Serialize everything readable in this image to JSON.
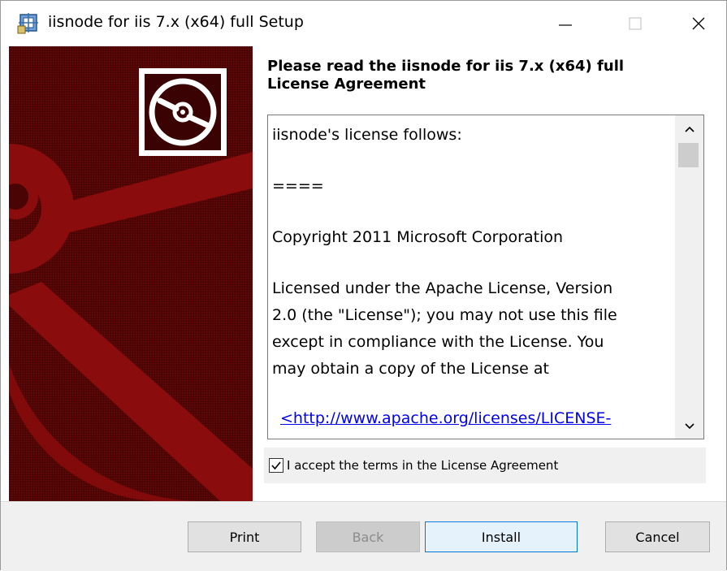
{
  "window": {
    "title": "iisnode for iis 7.x (x64) full Setup"
  },
  "heading": {
    "line1": "Please read the iisnode for iis 7.x (x64) full",
    "line2": "License Agreement"
  },
  "license": {
    "paragraphs": [
      "iisnode's license follows:",
      "====",
      "Copyright 2011 Microsoft Corporation"
    ],
    "apache_lines": [
      "Licensed under the Apache License, Version",
      "2.0 (the \"License\"); you may not use this file",
      "except in compliance with the License. You",
      "may  obtain a copy of the License at"
    ],
    "link_text": "<http://www.apache.org/licenses/LICENSE-"
  },
  "accept": {
    "checked": true,
    "label": "I accept the terms in the License Agreement"
  },
  "buttons": {
    "print": "Print",
    "back": "Back",
    "install": "Install",
    "cancel": "Cancel"
  },
  "icons": {
    "app": "installer-package-icon",
    "minimize": "minimize-icon",
    "maximize": "maximize-icon",
    "close": "close-icon",
    "banner": "cd-disc-icon",
    "scroll_up": "chevron-up-icon",
    "scroll_down": "chevron-down-icon"
  },
  "colors": {
    "banner_bg": "#5a0606",
    "banner_shape": "#8a0c0c",
    "link": "#0000ee",
    "install_border": "#0078d7"
  }
}
